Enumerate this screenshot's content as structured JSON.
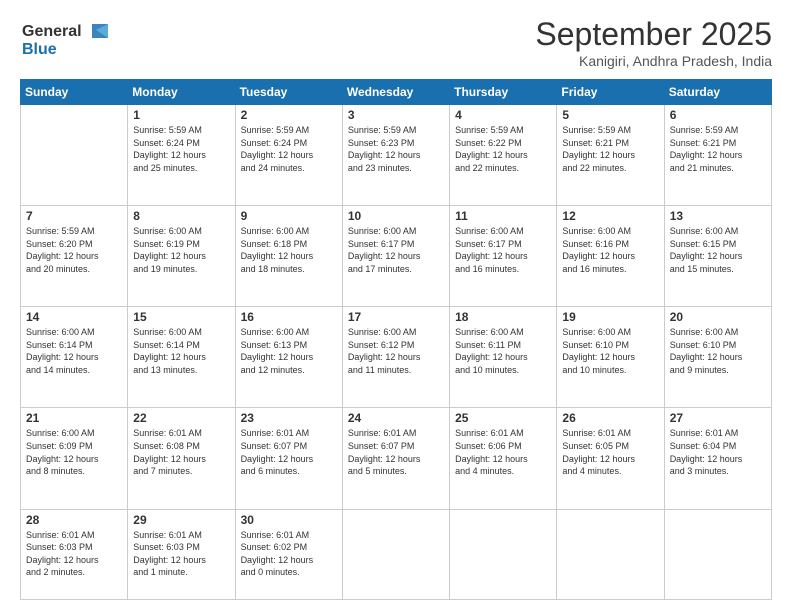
{
  "header": {
    "logo_line1": "General",
    "logo_line2": "Blue",
    "month": "September 2025",
    "location": "Kanigiri, Andhra Pradesh, India"
  },
  "weekdays": [
    "Sunday",
    "Monday",
    "Tuesday",
    "Wednesday",
    "Thursday",
    "Friday",
    "Saturday"
  ],
  "weeks": [
    [
      {
        "day": "",
        "text": ""
      },
      {
        "day": "1",
        "text": "Sunrise: 5:59 AM\nSunset: 6:24 PM\nDaylight: 12 hours\nand 25 minutes."
      },
      {
        "day": "2",
        "text": "Sunrise: 5:59 AM\nSunset: 6:24 PM\nDaylight: 12 hours\nand 24 minutes."
      },
      {
        "day": "3",
        "text": "Sunrise: 5:59 AM\nSunset: 6:23 PM\nDaylight: 12 hours\nand 23 minutes."
      },
      {
        "day": "4",
        "text": "Sunrise: 5:59 AM\nSunset: 6:22 PM\nDaylight: 12 hours\nand 22 minutes."
      },
      {
        "day": "5",
        "text": "Sunrise: 5:59 AM\nSunset: 6:21 PM\nDaylight: 12 hours\nand 22 minutes."
      },
      {
        "day": "6",
        "text": "Sunrise: 5:59 AM\nSunset: 6:21 PM\nDaylight: 12 hours\nand 21 minutes."
      }
    ],
    [
      {
        "day": "7",
        "text": "Sunrise: 5:59 AM\nSunset: 6:20 PM\nDaylight: 12 hours\nand 20 minutes."
      },
      {
        "day": "8",
        "text": "Sunrise: 6:00 AM\nSunset: 6:19 PM\nDaylight: 12 hours\nand 19 minutes."
      },
      {
        "day": "9",
        "text": "Sunrise: 6:00 AM\nSunset: 6:18 PM\nDaylight: 12 hours\nand 18 minutes."
      },
      {
        "day": "10",
        "text": "Sunrise: 6:00 AM\nSunset: 6:17 PM\nDaylight: 12 hours\nand 17 minutes."
      },
      {
        "day": "11",
        "text": "Sunrise: 6:00 AM\nSunset: 6:17 PM\nDaylight: 12 hours\nand 16 minutes."
      },
      {
        "day": "12",
        "text": "Sunrise: 6:00 AM\nSunset: 6:16 PM\nDaylight: 12 hours\nand 16 minutes."
      },
      {
        "day": "13",
        "text": "Sunrise: 6:00 AM\nSunset: 6:15 PM\nDaylight: 12 hours\nand 15 minutes."
      }
    ],
    [
      {
        "day": "14",
        "text": "Sunrise: 6:00 AM\nSunset: 6:14 PM\nDaylight: 12 hours\nand 14 minutes."
      },
      {
        "day": "15",
        "text": "Sunrise: 6:00 AM\nSunset: 6:14 PM\nDaylight: 12 hours\nand 13 minutes."
      },
      {
        "day": "16",
        "text": "Sunrise: 6:00 AM\nSunset: 6:13 PM\nDaylight: 12 hours\nand 12 minutes."
      },
      {
        "day": "17",
        "text": "Sunrise: 6:00 AM\nSunset: 6:12 PM\nDaylight: 12 hours\nand 11 minutes."
      },
      {
        "day": "18",
        "text": "Sunrise: 6:00 AM\nSunset: 6:11 PM\nDaylight: 12 hours\nand 10 minutes."
      },
      {
        "day": "19",
        "text": "Sunrise: 6:00 AM\nSunset: 6:10 PM\nDaylight: 12 hours\nand 10 minutes."
      },
      {
        "day": "20",
        "text": "Sunrise: 6:00 AM\nSunset: 6:10 PM\nDaylight: 12 hours\nand 9 minutes."
      }
    ],
    [
      {
        "day": "21",
        "text": "Sunrise: 6:00 AM\nSunset: 6:09 PM\nDaylight: 12 hours\nand 8 minutes."
      },
      {
        "day": "22",
        "text": "Sunrise: 6:01 AM\nSunset: 6:08 PM\nDaylight: 12 hours\nand 7 minutes."
      },
      {
        "day": "23",
        "text": "Sunrise: 6:01 AM\nSunset: 6:07 PM\nDaylight: 12 hours\nand 6 minutes."
      },
      {
        "day": "24",
        "text": "Sunrise: 6:01 AM\nSunset: 6:07 PM\nDaylight: 12 hours\nand 5 minutes."
      },
      {
        "day": "25",
        "text": "Sunrise: 6:01 AM\nSunset: 6:06 PM\nDaylight: 12 hours\nand 4 minutes."
      },
      {
        "day": "26",
        "text": "Sunrise: 6:01 AM\nSunset: 6:05 PM\nDaylight: 12 hours\nand 4 minutes."
      },
      {
        "day": "27",
        "text": "Sunrise: 6:01 AM\nSunset: 6:04 PM\nDaylight: 12 hours\nand 3 minutes."
      }
    ],
    [
      {
        "day": "28",
        "text": "Sunrise: 6:01 AM\nSunset: 6:03 PM\nDaylight: 12 hours\nand 2 minutes."
      },
      {
        "day": "29",
        "text": "Sunrise: 6:01 AM\nSunset: 6:03 PM\nDaylight: 12 hours\nand 1 minute."
      },
      {
        "day": "30",
        "text": "Sunrise: 6:01 AM\nSunset: 6:02 PM\nDaylight: 12 hours\nand 0 minutes."
      },
      {
        "day": "",
        "text": ""
      },
      {
        "day": "",
        "text": ""
      },
      {
        "day": "",
        "text": ""
      },
      {
        "day": "",
        "text": ""
      }
    ]
  ]
}
